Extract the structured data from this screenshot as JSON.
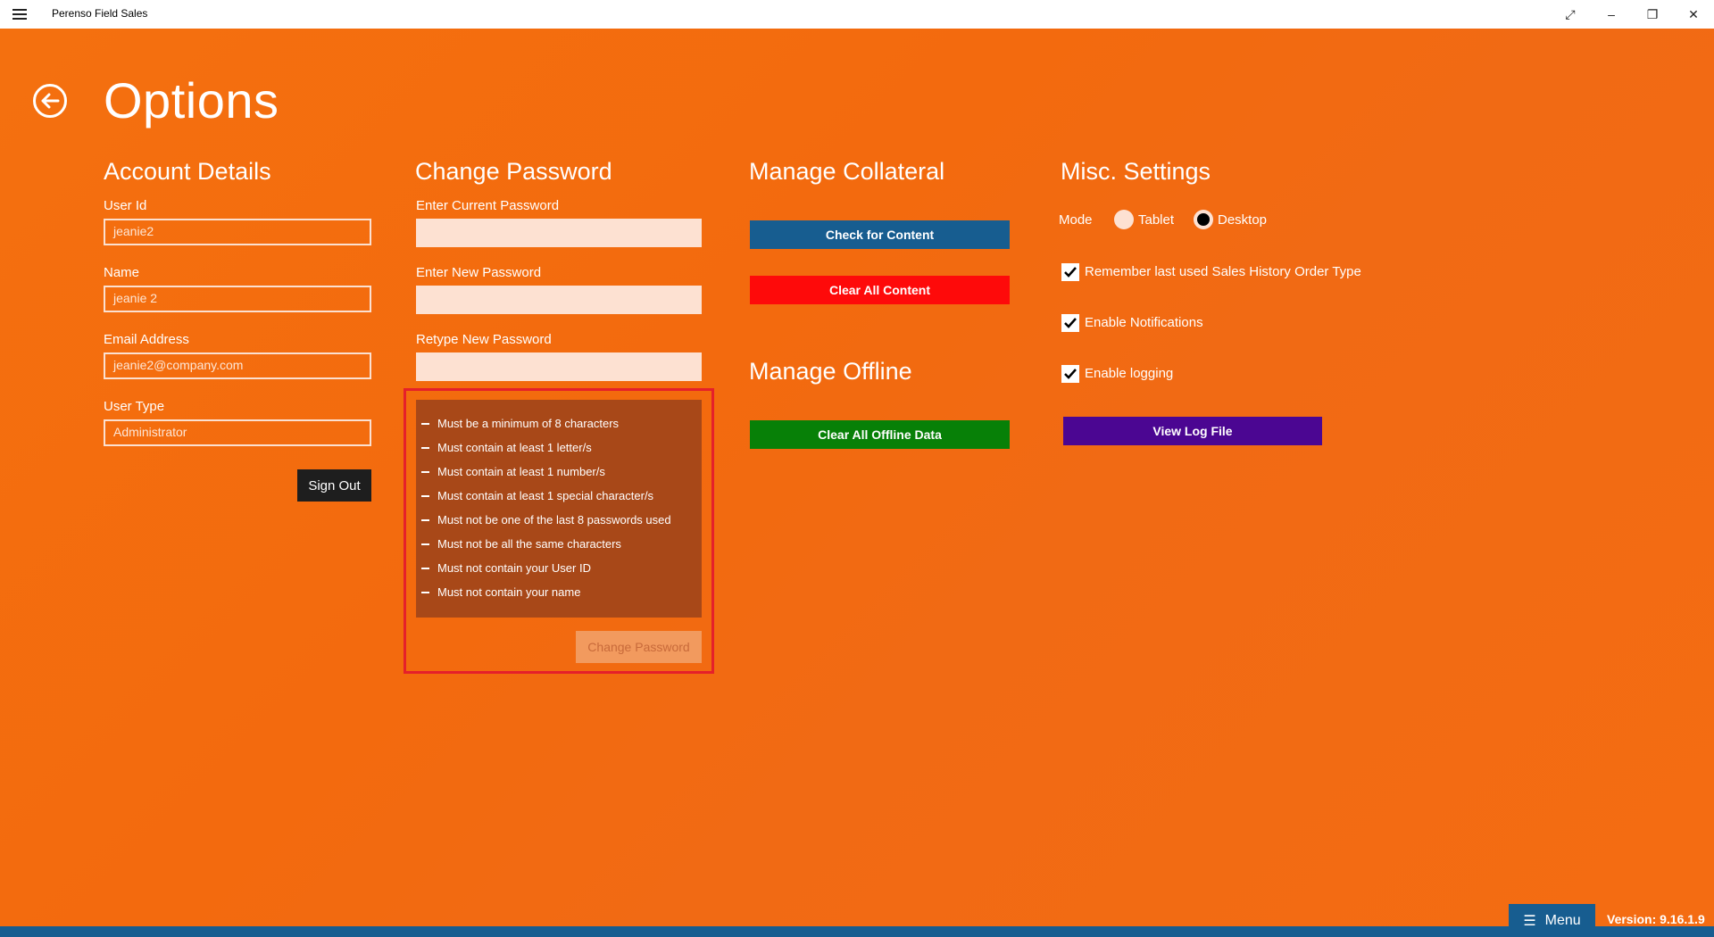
{
  "app": {
    "title": "Perenso Field Sales",
    "version": "Version: 9.16.1.9",
    "menu_label": "Menu",
    "menu_icon": "☰"
  },
  "titlebar": {
    "hamburger_icon": "hamburger-icon",
    "expand_icon": "⤢",
    "minimize_icon": "–",
    "restore_icon": "❐",
    "close_icon": "✕"
  },
  "page": {
    "title": "Options",
    "back_icon": "←"
  },
  "account": {
    "title": "Account Details",
    "user_id_label": "User Id",
    "user_id_value": "jeanie2",
    "name_label": "Name",
    "name_value": "jeanie 2",
    "email_label": "Email Address",
    "email_value": "jeanie2@company.com",
    "user_type_label": "User Type",
    "user_type_value": "Administrator",
    "sign_out_label": "Sign Out"
  },
  "password": {
    "title": "Change Password",
    "current_label": "Enter Current Password",
    "new_label": "Enter New Password",
    "retype_label": "Retype New Password",
    "rules": [
      "Must be a minimum of 8 characters",
      "Must contain at least 1 letter/s",
      "Must contain at least 1 number/s",
      "Must contain at least 1 special character/s",
      "Must not be one of the last 8 passwords used",
      "Must not be all the same characters",
      "Must not contain your User ID",
      "Must not contain your name"
    ],
    "change_button_label": "Change Password"
  },
  "collateral": {
    "title": "Manage Collateral",
    "check_content_label": "Check for Content",
    "clear_content_label": "Clear All Content"
  },
  "offline": {
    "title": "Manage Offline",
    "clear_offline_label": "Clear All Offline Data"
  },
  "misc": {
    "title": "Misc. Settings",
    "mode_label": "Mode",
    "mode_options": [
      "Tablet",
      "Desktop"
    ],
    "mode_selected": "Desktop",
    "remember_label": "Remember last used Sales History Order Type",
    "remember_checked": true,
    "notifications_label": "Enable Notifications",
    "notifications_checked": true,
    "logging_label": "Enable logging",
    "logging_checked": true,
    "view_log_label": "View Log File"
  },
  "colors": {
    "background": "#f26a10",
    "check_content": "#175d90",
    "clear_content": "#fe0a0a",
    "clear_offline": "#078007",
    "view_log": "#4b0692",
    "sign_out": "#1e1e1e",
    "rules_box": "#a84818",
    "rules_frame": "#e5202a",
    "menu_bar": "#175d90"
  }
}
